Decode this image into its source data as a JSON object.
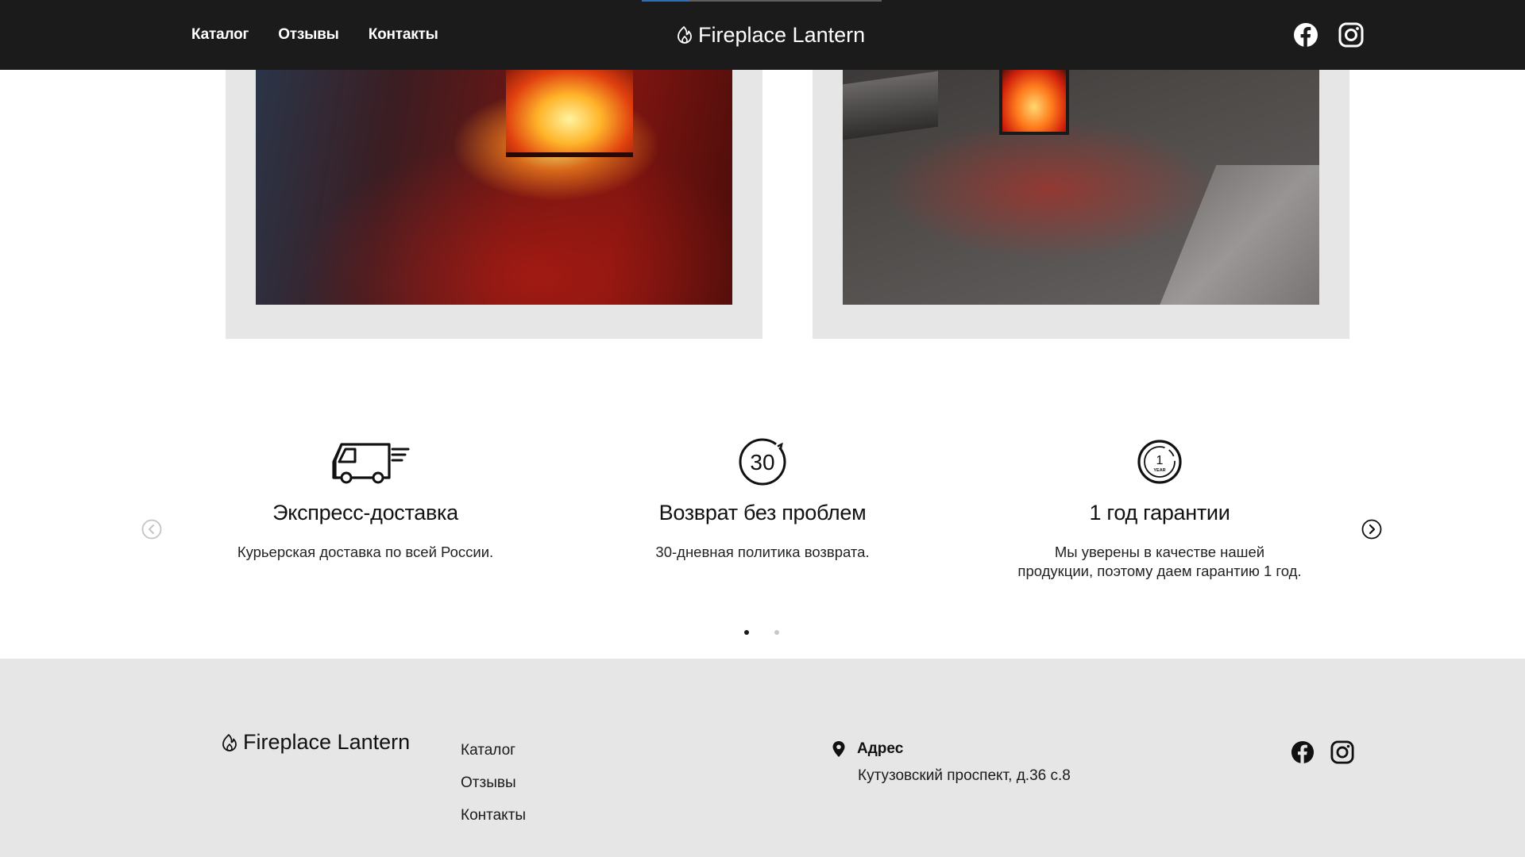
{
  "header": {
    "nav": [
      {
        "label": "Каталог"
      },
      {
        "label": "Отзывы"
      },
      {
        "label": "Контакты"
      }
    ],
    "brand": "Fireplace Lantern",
    "progress_fraction": 0.2,
    "social": [
      {
        "icon": "facebook-icon"
      },
      {
        "icon": "instagram-icon"
      }
    ]
  },
  "reviews": {
    "cards": [
      {
        "photo": "fireplace-lantern-on-floor-photo"
      },
      {
        "photo": "fireplace-lantern-on-windowsill-photo"
      }
    ]
  },
  "features": {
    "items": [
      {
        "icon": "delivery-truck-icon",
        "title": "Экспресс-доставка",
        "text": "Курьерская доставка по всей России."
      },
      {
        "icon": "30-day-return-icon",
        "icon_text": "30",
        "title": "Возврат без проблем",
        "text": "30-дневная политика возврата."
      },
      {
        "icon": "one-year-warranty-icon",
        "icon_text": "1",
        "icon_subtext": "YEAR",
        "title": "1 год гарантии",
        "text_line1": "Мы уверены в качестве нашей",
        "text_line2": "продукции, поэтому даем гарантию 1 год."
      }
    ],
    "pagination": {
      "active": 1,
      "total": 2
    }
  },
  "footer": {
    "brand": "Fireplace Lantern",
    "nav": [
      {
        "label": "Каталог"
      },
      {
        "label": "Отзывы"
      },
      {
        "label": "Контакты"
      }
    ],
    "address": {
      "label": "Адрес",
      "value": "Кутузовский проспект, д.36 с.8"
    },
    "social": [
      {
        "icon": "facebook-icon"
      },
      {
        "icon": "instagram-icon"
      }
    ]
  },
  "colors": {
    "header_bg": "#1b1b1b",
    "footer_bg": "#e6e6e6",
    "card_bg": "#e6e6e6",
    "progress_accent": "#2e6fb8"
  }
}
